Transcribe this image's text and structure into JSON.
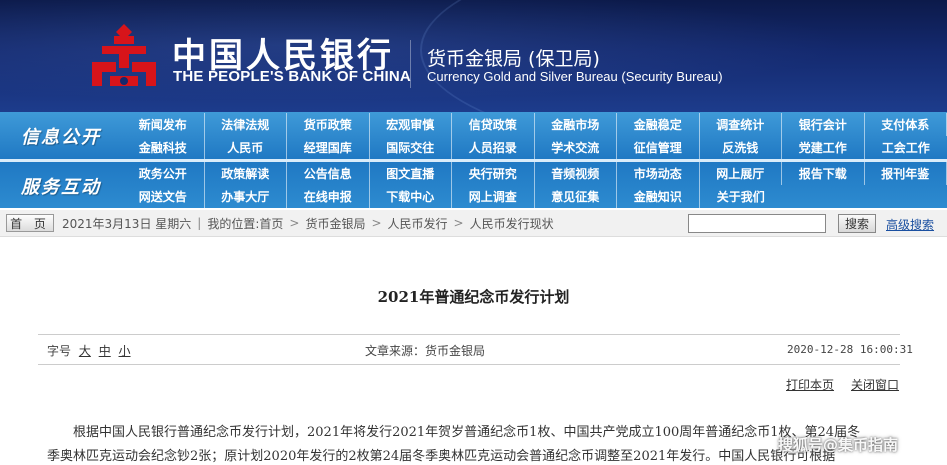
{
  "header": {
    "cn_name": "中国人民银行",
    "en_name": "THE PEOPLE'S BANK OF CHINA",
    "bureau_cn": "货币金银局 (保卫局)",
    "bureau_en": "Currency  Gold and Silver Bureau (Security Bureau)",
    "logo_icon": "pboc-logo-icon",
    "colors": {
      "banner": "#14296e",
      "logo_red": "#d7141a",
      "nav": "#1f78c3"
    }
  },
  "nav": {
    "section1_label": "信息公开",
    "section1_items": [
      "新闻发布",
      "法律法规",
      "货币政策",
      "宏观审慎",
      "信贷政策",
      "金融市场",
      "金融稳定",
      "调查统计",
      "银行会计",
      "支付体系",
      "金融科技",
      "人民币",
      "经理国库",
      "国际交往",
      "人员招录",
      "学术交流",
      "征信管理",
      "反洗钱",
      "党建工作",
      "工会工作"
    ],
    "section2_label": "服务互动",
    "section2_items": [
      "政务公开",
      "政策解读",
      "公告信息",
      "图文直播",
      "央行研究",
      "音频视频",
      "市场动态",
      "网上展厅",
      "报告下载",
      "报刊年鉴",
      "网送文告",
      "办事大厅",
      "在线申报",
      "下载中心",
      "网上调查",
      "意见征集",
      "金融知识",
      "关于我们"
    ]
  },
  "breadcrumb": {
    "home_button": "首 页",
    "date": "2021年3月13日 星期六",
    "location_label": "我的位置:",
    "items": [
      "首页",
      "货币金银局",
      "人民币发行",
      "人民币发行现状"
    ],
    "separator": ">",
    "search_placeholder": "",
    "search_button": "搜索",
    "advanced_search": "高级搜索"
  },
  "article": {
    "title": "2021年普通纪念币发行计划",
    "font_size_label": "字号",
    "font_sizes": [
      "大",
      "中",
      "小"
    ],
    "source": "文章来源：货币金银局",
    "datetime": "2020-12-28 16:00:31",
    "print_link": "打印本页",
    "close_link": "关闭窗口",
    "paragraph_lines": [
      "根据中国人民银行普通纪念币发行计划，2021年将发行2021年贺岁普通纪念币1枚、中国共产党成立100周年普通纪念币1枚、第24届冬",
      "季奥林匹克运动会纪念钞2张；原计划2020年发行的2枚第24届冬季奥林匹克运动会普通纪念币调整至2021年发行。中国人民银行可根据"
    ]
  },
  "watermark": "搜狐号@集币指南"
}
